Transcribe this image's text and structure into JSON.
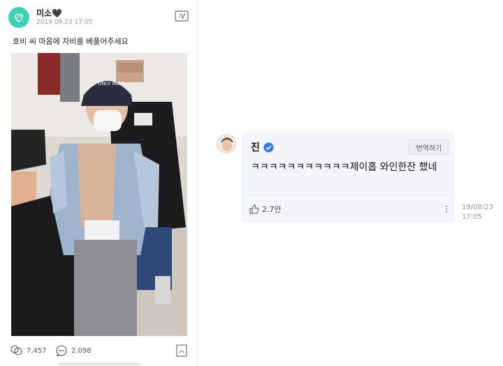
{
  "post": {
    "author": "미소🖤",
    "date": "2019.08.23 17:05",
    "text": "호비 씨 마음에 자비를 베풀어주세요",
    "stats": {
      "likes": "7,457",
      "comments": "2,098"
    },
    "photo_text": {
      "cap_text": "ONLY ALLS"
    }
  },
  "reply": {
    "name": "진",
    "translate_label": "번역하기",
    "text": "ㅋㅋㅋㅋㅋㅋㅋㅋㅋㅋㅋ제이홉 와인한잔 했네",
    "likes": "2.7만",
    "date": "19/08/23",
    "time": "17:05"
  },
  "colors": {
    "brand_mint": "#3fcfb3",
    "verified_blue": "#2e7cf6",
    "bubble_bg": "#f4f5f9"
  },
  "icons": {
    "avatar": "heart-logo-icon",
    "translate": "translate-icon",
    "like": "thumbs-up-icon",
    "comment": "comment-icon",
    "bookmark": "bookmark-icon",
    "more": "more-vertical-icon",
    "verified": "verified-check-icon"
  }
}
